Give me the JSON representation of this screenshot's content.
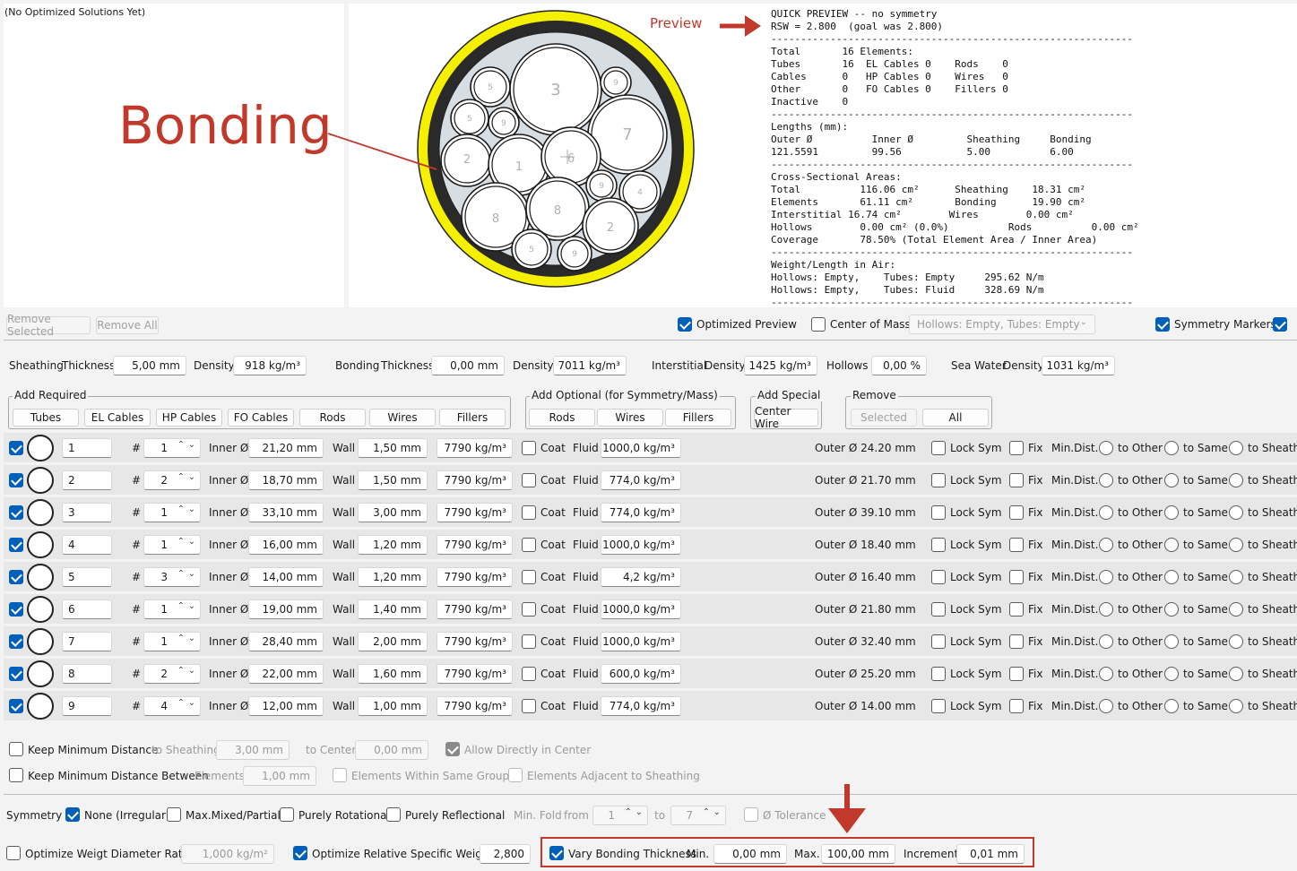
{
  "no_solutions": "(No Optimized Solutions Yet)",
  "annotations": {
    "preview": "Preview",
    "bonding": "Bonding",
    "accent": "#c0392b"
  },
  "preview_text": "QUICK PREVIEW -- no symmetry\nRSW = 2.800  (goal was 2.800)\n-------------------------------------------------------------\nTotal       16 Elements:\nTubes       16  EL Cables 0    Rods    0\nCables      0   HP Cables 0    Wires   0\nOther       0   FO Cables 0    Fillers 0\nInactive    0\n-------------------------------------------------------------\nLengths (mm):\nOuter Ø          Inner Ø         Sheathing     Bonding\n121.5591         99.56           5.00          6.00\n-------------------------------------------------------------\nCross-Sectional Areas:\nTotal          116.06 cm²      Sheathing    18.31 cm²\nElements       61.11 cm²       Bonding      19.90 cm²\nInterstitial 16.74 cm²        Wires        0.00 cm²\nHollows        0.00 cm² (0.0%)          Rods          0.00 cm²\nCoverage       78.50% (Total Element Area / Inner Area)\n-------------------------------------------------------------\nWeight/Length in Air:\nHollows: Empty,    Tubes: Empty     295.62 N/m\nHollows: Empty,    Tubes: Fluid     328.69 N/m\n-------------------------------------------------------------",
  "cross_section_labels": [
    "3",
    "9",
    "5",
    "5",
    "9",
    "7",
    "2",
    "1",
    "6",
    "9",
    "4",
    "8",
    "8",
    "2",
    "5",
    "9"
  ],
  "toolbar": {
    "remove_selected": "Remove Selected",
    "remove_all": "Remove All",
    "optimized_preview": "Optimized Preview",
    "center_of_mass": "Center of Mass",
    "hollows_select": "Hollows: Empty, Tubes: Empty",
    "symmetry_markers": "Symmetry Markers"
  },
  "props": {
    "sheathing": "Sheathing",
    "thickness": "Thickness",
    "sheathing_thickness": "5,00 mm",
    "density": "Density",
    "sheathing_density": "918 kg/m³",
    "bonding": "Bonding",
    "bonding_thickness": "0,00 mm",
    "bonding_density": "7011 kg/m³",
    "interstitial": "Interstitial",
    "interstitial_density": "1425 kg/m³",
    "hollows": "Hollows",
    "hollows_value": "0,00 %",
    "sea_water": "Sea Water",
    "sea_water_density": "1031 kg/m³"
  },
  "groups": {
    "add_required": "Add Required",
    "required_buttons": [
      "Tubes",
      "EL Cables",
      "HP Cables",
      "FO Cables",
      "Rods",
      "Wires",
      "Fillers"
    ],
    "add_optional": "Add Optional (for Symmetry/Mass)",
    "optional_buttons": [
      "Rods",
      "Wires",
      "Fillers"
    ],
    "add_special": "Add Special",
    "special_buttons": [
      "Center Wire"
    ],
    "remove": "Remove",
    "remove_buttons": [
      "Selected",
      "All"
    ]
  },
  "row_labels": {
    "hash": "#",
    "inner": "Inner Ø",
    "wall": "Wall",
    "coat": "Coat",
    "fluid": "Fluid",
    "lock_sym": "Lock Sym",
    "fix": "Fix",
    "min_dist": "Min.Dist.",
    "to_other": "to Other",
    "to_same": "to Same",
    "to_sheath": "to Sheath"
  },
  "elements": [
    {
      "name": "1",
      "count": "1",
      "inner": "21,20 mm",
      "wall": "1,50 mm",
      "density": "7790 kg/m³",
      "fluid": "1000,0 kg/m³",
      "outer": "Outer Ø 24.20 mm"
    },
    {
      "name": "2",
      "count": "2",
      "inner": "18,70 mm",
      "wall": "1,50 mm",
      "density": "7790 kg/m³",
      "fluid": "774,0 kg/m³",
      "outer": "Outer Ø 21.70 mm"
    },
    {
      "name": "3",
      "count": "1",
      "inner": "33,10 mm",
      "wall": "3,00 mm",
      "density": "7790 kg/m³",
      "fluid": "774,0 kg/m³",
      "outer": "Outer Ø 39.10 mm"
    },
    {
      "name": "4",
      "count": "1",
      "inner": "16,00 mm",
      "wall": "1,20 mm",
      "density": "7790 kg/m³",
      "fluid": "1000,0 kg/m³",
      "outer": "Outer Ø 18.40 mm"
    },
    {
      "name": "5",
      "count": "3",
      "inner": "14,00 mm",
      "wall": "1,20 mm",
      "density": "7790 kg/m³",
      "fluid": "4,2 kg/m³",
      "outer": "Outer Ø 16.40 mm"
    },
    {
      "name": "6",
      "count": "1",
      "inner": "19,00 mm",
      "wall": "1,40 mm",
      "density": "7790 kg/m³",
      "fluid": "1000,0 kg/m³",
      "outer": "Outer Ø 21.80 mm"
    },
    {
      "name": "7",
      "count": "1",
      "inner": "28,40 mm",
      "wall": "2,00 mm",
      "density": "7790 kg/m³",
      "fluid": "1000,0 kg/m³",
      "outer": "Outer Ø 32.40 mm"
    },
    {
      "name": "8",
      "count": "2",
      "inner": "22,00 mm",
      "wall": "1,60 mm",
      "density": "7790 kg/m³",
      "fluid": "600,0 kg/m³",
      "outer": "Outer Ø 25.20 mm"
    },
    {
      "name": "9",
      "count": "4",
      "inner": "12,00 mm",
      "wall": "1,00 mm",
      "density": "7790 kg/m³",
      "fluid": "774,0 kg/m³",
      "outer": "Outer Ø 14.00 mm"
    }
  ],
  "min_distance": {
    "keep_min_distance": "Keep Minimum Distance",
    "to_sheathing": "to Sheathing",
    "to_sheathing_value": "3,00 mm",
    "to_center": "to Center",
    "to_center_value": "0,00 mm",
    "allow_center": "Allow Directly in Center",
    "keep_between": "Keep Minimum Distance Between",
    "elements": "Elements",
    "elements_value": "1,00 mm",
    "within_group": "Elements Within Same Group",
    "adjacent_sheathing": "Elements Adjacent to Sheathing"
  },
  "symmetry": {
    "label": "Symmetry",
    "none": "None (Irregular)",
    "max_mixed": "Max.Mixed/Partial",
    "rotational": "Purely Rotational",
    "reflectional": "Purely Reflectional",
    "min_fold": "Min. Fold",
    "from": "from",
    "from_value": "1",
    "to": "to",
    "to_value": "7",
    "tolerance": "Ø Tolerance"
  },
  "optimize": {
    "weight_ratio": "Optimize Weigt Diameter Ratio",
    "weight_ratio_value": "1,000 kg/m²",
    "rsw": "Optimize Relative Specific Weight",
    "rsw_value": "2,800",
    "vary_bonding": "Vary Bonding Thickness",
    "min": "Min.",
    "min_value": "0,00 mm",
    "max": "Max.",
    "max_value": "100,00 mm",
    "increment": "Increment",
    "increment_value": "0,01 mm"
  }
}
